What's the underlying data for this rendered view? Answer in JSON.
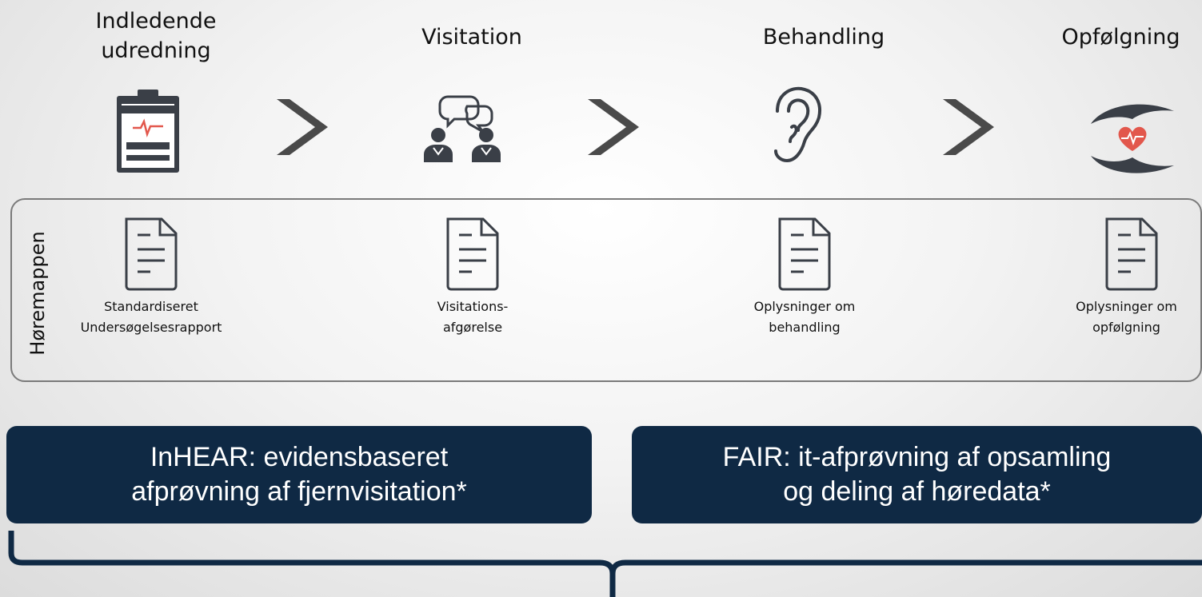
{
  "stages": [
    {
      "title": "Indledende udredning",
      "icon": "clipboard-icon"
    },
    {
      "title": "Visitation",
      "icon": "consultation-icon"
    },
    {
      "title": "Behandling",
      "icon": "ear-icon"
    },
    {
      "title": "Opfølgning",
      "icon": "care-hands-icon"
    }
  ],
  "panel": {
    "label": "Høremappen",
    "documents": [
      {
        "line1": "Standardiseret",
        "line2": "Undersøgelsesrapport"
      },
      {
        "line1": "Visitations-",
        "line2": "afgørelse"
      },
      {
        "line1": "Oplysninger om",
        "line2": "behandling"
      },
      {
        "line1": "Oplysninger om",
        "line2": "opfølgning"
      }
    ]
  },
  "projects": {
    "left": {
      "line1": "InHEAR: evidensbaseret",
      "line2": "afprøvning af fjernvisitation*"
    },
    "right": {
      "line1": "FAIR: it-afprøvning af opsamling",
      "line2": "og deling af høredata*"
    }
  },
  "colors": {
    "box": "#0f2944",
    "icon": "#3a3f47",
    "accent": "#e2574c",
    "chevron": "#4a4a4a"
  }
}
